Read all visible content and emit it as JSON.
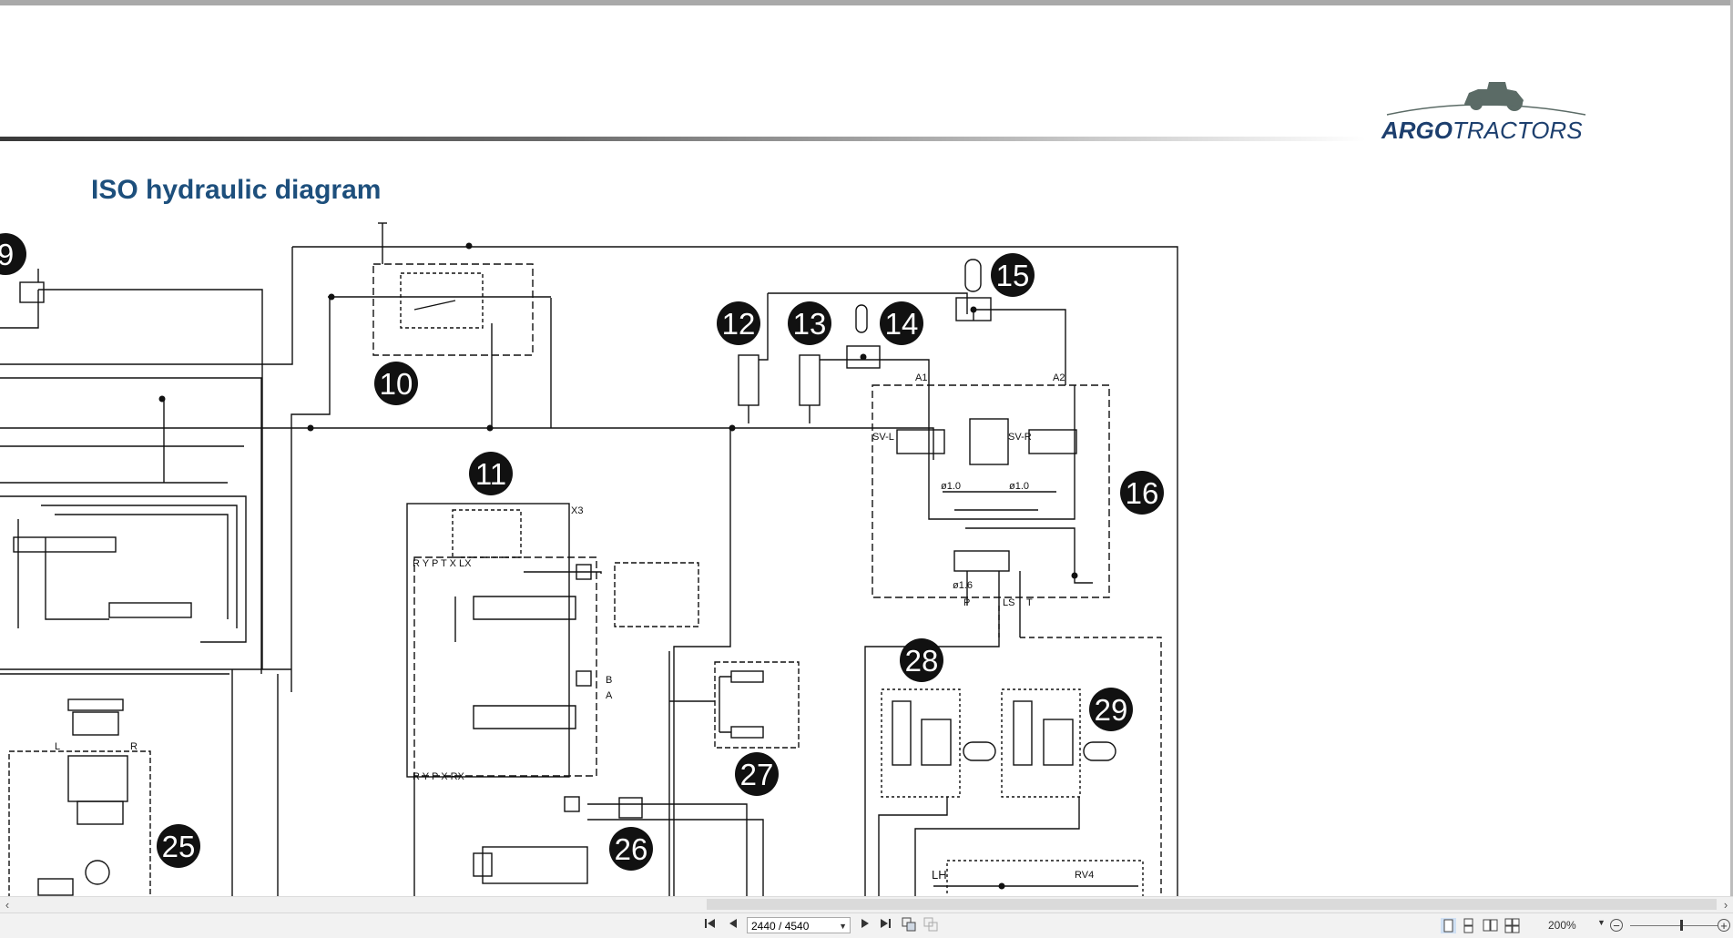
{
  "page": {
    "title": "ISO hydraulic diagram",
    "logo_brand_bold": "ARGO",
    "logo_brand_light": "TRACTORS"
  },
  "diagram": {
    "component_numbers": [
      "9",
      "10",
      "11",
      "12",
      "13",
      "14",
      "15",
      "16",
      "25",
      "26",
      "27",
      "28",
      "29"
    ],
    "labels": {
      "a1": "A1",
      "a2": "A2",
      "sv_l": "SV-L",
      "sv_r": "SV-R",
      "p": "P",
      "ls": "LS",
      "t": "T",
      "lh": "LH",
      "rv4": "RV4",
      "l": "L",
      "r": "R",
      "x3": "X3",
      "a": "A",
      "b": "B",
      "orifice1": "ø1.0",
      "orifice2": "ø1.0",
      "orifice3": "ø1.6",
      "port_row_1": "R  Y  P  T  X  LX",
      "port_row_2": "R  Y  P  X  RX"
    }
  },
  "toolbar": {
    "first_page_icon": "first-page-icon",
    "prev_page_icon": "prev-page-icon",
    "page_indicator": "2440 / 4540",
    "next_page_icon": "next-page-icon",
    "last_page_icon": "last-page-icon",
    "zoom_level": "200%"
  },
  "colors": {
    "title": "#1d4f7c",
    "logo": "#5b6b66",
    "badge": "#111111"
  }
}
